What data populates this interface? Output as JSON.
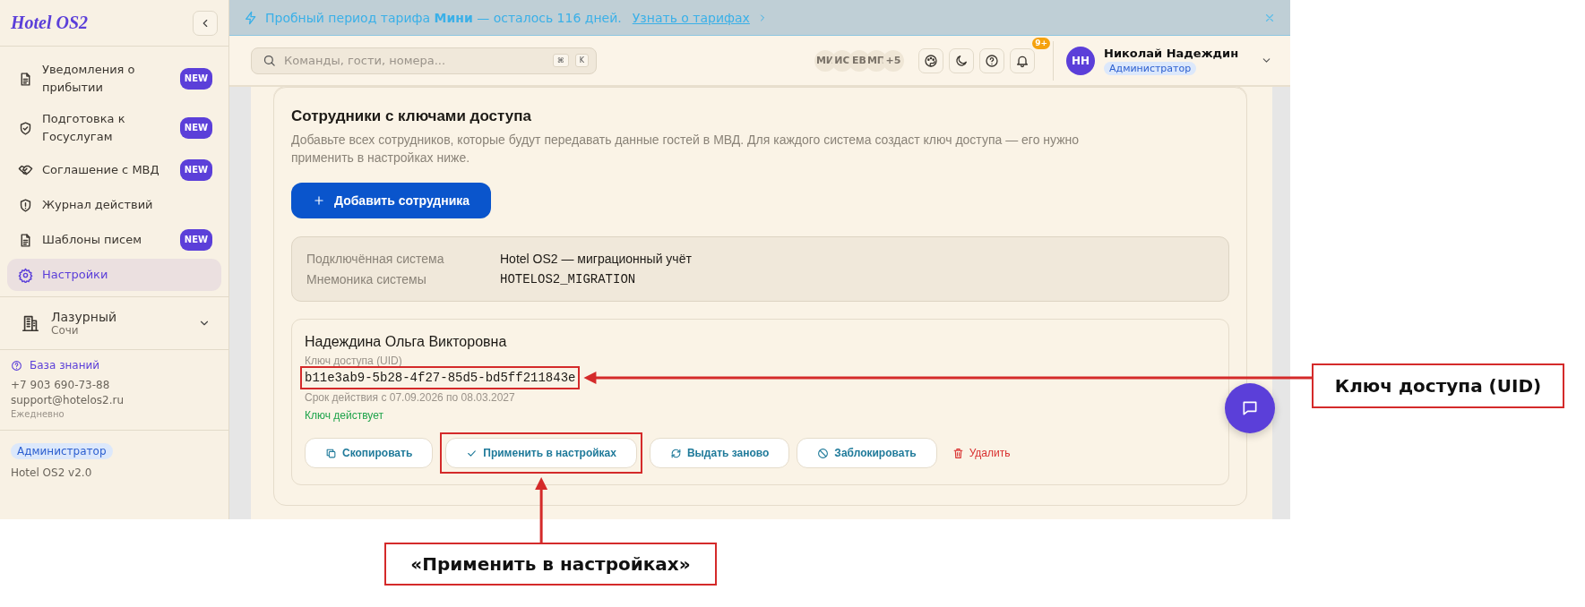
{
  "sidebar": {
    "logo": "Hotel OS2",
    "items": [
      {
        "label": "Уведомления о прибытии",
        "badge": "NEW",
        "selected": false
      },
      {
        "label": "Подготовка к Госуслугам",
        "badge": "NEW",
        "selected": false
      },
      {
        "label": "Соглашение с МВД",
        "badge": "NEW",
        "selected": false
      },
      {
        "label": "Журнал действий",
        "selected": false
      },
      {
        "label": "Шаблоны писем",
        "badge": "NEW",
        "selected": false
      },
      {
        "label": "Настройки",
        "selected": true
      }
    ],
    "hotel": {
      "name": "Лазурный",
      "city": "Сочи"
    },
    "help": {
      "link": "База знаний",
      "phone": "+7 903 690-73-88",
      "email": "support@hotelos2.ru",
      "hours": "Ежедневно"
    },
    "role": "Администратор",
    "version": "Hotel OS2 v2.0"
  },
  "banner": {
    "text": "Пробный период тарифа **Мини** — осталось 116 дней.",
    "link": "Узнать о тарифах"
  },
  "topbar": {
    "search": {
      "placeholder": "Команды, гости, номера...",
      "keys": [
        "⌘",
        "K"
      ]
    },
    "avatars": [
      "МИ",
      "ИС",
      "ЕВ",
      "МП",
      "+5"
    ],
    "notifications": "9+",
    "user": {
      "initials": "НН",
      "name": "Николай Надеждин",
      "role": "Администратор"
    }
  },
  "section": {
    "title": "Сотрудники с ключами доступа",
    "description": "Добавьте всех сотрудников, которые будут передавать данные гостей в МВД. Для каждого система создаст ключ доступа — его нужно применить в настройках ниже.",
    "add_button": "Добавить сотрудника",
    "system": [
      {
        "label": "Подключённая система",
        "value": "Hotel OS2 — миграционный учёт",
        "kind": "text"
      },
      {
        "label": "Мнемоника системы",
        "value": "HOTELOS2_MIGRATION",
        "kind": "mono"
      }
    ],
    "employee": {
      "name": "Надеждина Ольга Викторовна",
      "key_label": "Ключ доступа (UID)",
      "uid": "b11e3ab9-5b28-4f27-85d5-bd5ff211843e",
      "uid_highlighted": true,
      "validity": "Срок действия с 07.09.2026 по 08.03.2027",
      "status": "Ключ действует",
      "key_active": true,
      "actions": [
        {
          "label": "Скопировать",
          "kind": "outline",
          "highlighted": false
        },
        {
          "label": "Применить в настройках",
          "kind": "outline",
          "highlighted": true
        },
        {
          "label": "Выдать заново",
          "kind": "outline",
          "highlighted": false
        },
        {
          "label": "Заблокировать",
          "kind": "outline",
          "highlighted": false
        },
        {
          "label": "Удалить",
          "kind": "danger",
          "highlighted": false
        }
      ]
    }
  },
  "annotations": [
    {
      "text": "Ключ доступа (UID)"
    },
    {
      "text": "«Применить в настройках»"
    }
  ]
}
